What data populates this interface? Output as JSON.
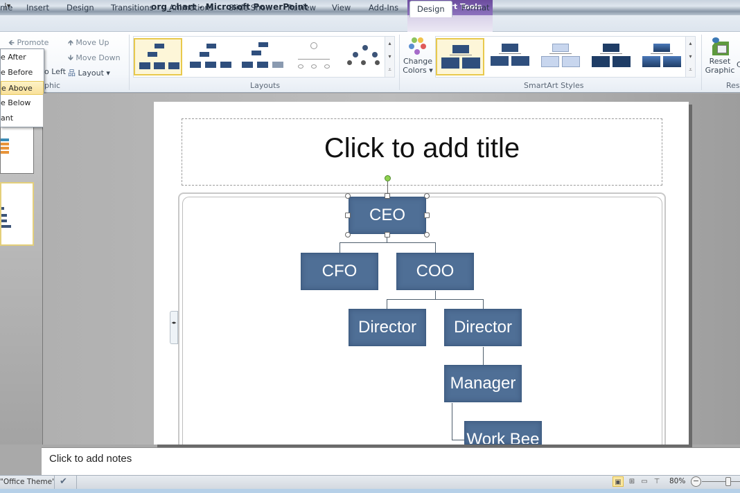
{
  "window": {
    "title": "org_chart - Microsoft PowerPoint",
    "qat_glyph": "▾",
    "contextual_group": "SmartArt Tools"
  },
  "tabs": [
    {
      "label": "me",
      "name": "home"
    },
    {
      "label": "Insert",
      "name": "insert"
    },
    {
      "label": "Design",
      "name": "design"
    },
    {
      "label": "Transitions",
      "name": "transitions"
    },
    {
      "label": "Animations",
      "name": "animations"
    },
    {
      "label": "Slide Show",
      "name": "slide-show"
    },
    {
      "label": "Review",
      "name": "review"
    },
    {
      "label": "View",
      "name": "view"
    },
    {
      "label": "Add-Ins",
      "name": "add-ins"
    },
    {
      "label": "Design",
      "name": "smartart-design",
      "active": true
    },
    {
      "label": "Format",
      "name": "smartart-format"
    }
  ],
  "ribbon": {
    "create_graphic": {
      "promote": "Promote",
      "move_up": "Move Up",
      "move_down": "Move Down",
      "right_to_left": "o Left",
      "layout": "Layout ▾",
      "group_label": "phic"
    },
    "layouts": {
      "group_label": "Layouts",
      "items": [
        "Organization Chart",
        "Name and Title Organization Chart",
        "Half Circle Organization Chart",
        "Horizontal Hierarchy",
        "Labeled Hierarchy"
      ],
      "selected_index": 0
    },
    "change_colors": {
      "line1": "Change",
      "line2": "Colors ▾"
    },
    "smartart_styles": {
      "group_label": "SmartArt Styles",
      "items": [
        "Simple Fill",
        "White Outline",
        "Subtle Effect",
        "Moderate Effect",
        "Intense Effect"
      ],
      "selected_index": 0
    },
    "reset": {
      "line1": "Reset",
      "line2": "Graphic",
      "group_label": "Res",
      "convert_partial": "C"
    }
  },
  "add_shape_menu": {
    "items": [
      {
        "label": "e After"
      },
      {
        "label": "e Before"
      },
      {
        "label": "e Above",
        "highlighted": true
      },
      {
        "label": "e Below"
      },
      {
        "label": "ant"
      }
    ]
  },
  "slide": {
    "title_placeholder": "Click to add title",
    "text_pane_arrows": "◂▸",
    "org_chart": {
      "nodes": [
        {
          "id": "ceo",
          "label": "CEO",
          "selected": true
        },
        {
          "id": "cfo",
          "label": "CFO",
          "parent": "ceo"
        },
        {
          "id": "coo",
          "label": "COO",
          "parent": "ceo"
        },
        {
          "id": "director1",
          "label": "Director",
          "parent": "coo"
        },
        {
          "id": "director2",
          "label": "Director",
          "parent": "coo"
        },
        {
          "id": "manager",
          "label": "Manager",
          "parent": "director2"
        },
        {
          "id": "workbee",
          "label": "Work Bee",
          "parent": "manager"
        }
      ]
    }
  },
  "notes": {
    "placeholder": "Click to add notes"
  },
  "statusbar": {
    "theme": "Office Theme\"",
    "zoom": "80%",
    "zoom_minus": "−",
    "view_buttons": [
      "Normal",
      "Slide Sorter",
      "Reading View",
      "Slide Show"
    ]
  },
  "colors": {
    "node_fill": "#4f6f96",
    "contextual_tab": "#7a5fb0",
    "selection_highlight": "#f9e19a",
    "rotation_handle": "#8fd14f"
  }
}
